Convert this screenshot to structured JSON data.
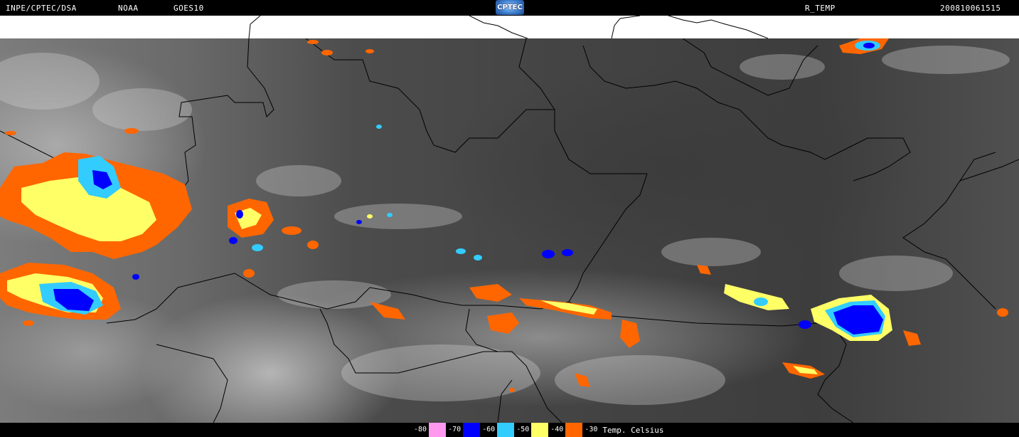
{
  "header": {
    "left_label": "INPE/CPTEC/DSA",
    "source_label": "NOAA",
    "satellite_label": "GOES10",
    "logo_text": "CPTEC",
    "product_label": "R_TEMP",
    "timestamp": "200810061515"
  },
  "legend": {
    "title": "Temp. Celsius",
    "items": [
      {
        "value": "-80",
        "color": "#ff99ee"
      },
      {
        "value": "-70",
        "color": "#0000ff"
      },
      {
        "value": "-60",
        "color": "#33ccff"
      },
      {
        "value": "-50",
        "color": "#ffff66"
      },
      {
        "value": "-40",
        "color": "#ff6600"
      },
      {
        "value": "-30",
        "color": ""
      }
    ]
  },
  "map": {
    "type": "satellite-ir-enhanced",
    "background": "#000000",
    "band_color": "#ffffff",
    "border_color": "#000000"
  }
}
